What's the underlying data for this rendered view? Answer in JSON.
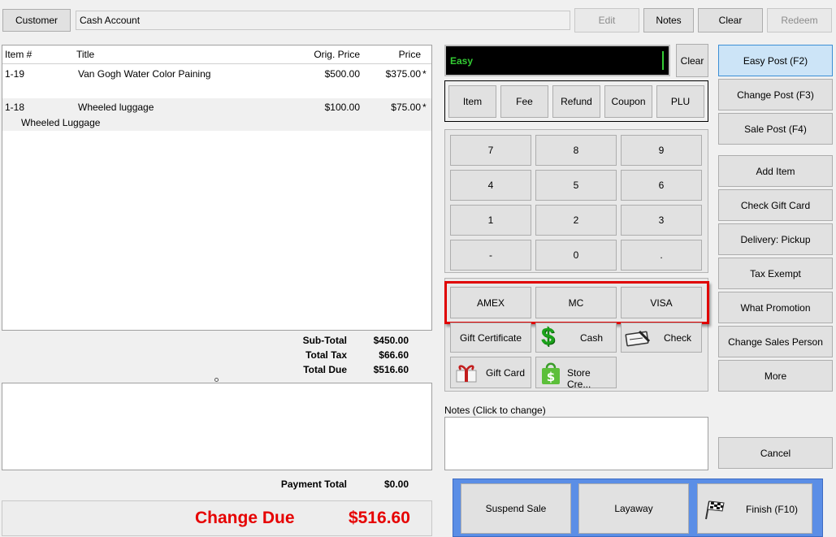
{
  "top": {
    "customer_button": "Customer",
    "customer_field": "Cash Account",
    "edit": "Edit",
    "notes": "Notes",
    "clear": "Clear",
    "redeem": "Redeem"
  },
  "items_table": {
    "headers": {
      "item_no": "Item #",
      "title": "Title",
      "orig_price": "Orig. Price",
      "price": "Price"
    },
    "rows": [
      {
        "item_no": "1-19",
        "title": "Van Gogh Water Color Paining",
        "orig_price": "$500.00",
        "price": "$375.00",
        "flag": "*",
        "sub": ""
      },
      {
        "item_no": "1-18",
        "title": "Wheeled luggage",
        "orig_price": "$100.00",
        "price": "$75.00",
        "flag": "*",
        "sub": "Wheeled Luggage"
      }
    ]
  },
  "totals": {
    "subtotal_label": "Sub-Total",
    "subtotal": "$450.00",
    "tax_label": "Total Tax",
    "tax": "$66.60",
    "due_label": "Total Due",
    "due": "$516.60",
    "payment_label": "Payment Total",
    "payment": "$0.00",
    "change_label": "Change Due",
    "change": "$516.60"
  },
  "entry": {
    "mode_text": "Easy",
    "clear": "Clear"
  },
  "type_buttons": [
    "Item",
    "Fee",
    "Refund",
    "Coupon",
    "PLU"
  ],
  "keypad": [
    "7",
    "8",
    "9",
    "4",
    "5",
    "6",
    "1",
    "2",
    "3",
    "-",
    "0",
    "."
  ],
  "cards": [
    "AMEX",
    "MC",
    "VISA"
  ],
  "tender": {
    "gift_certificate": "Gift Certificate",
    "cash": "Cash",
    "check": "Check",
    "gift_card": "Gift Card",
    "store_credit": "Store Cre..."
  },
  "notes_label": "Notes (Click to change)",
  "right_buttons": {
    "easy_post": "Easy Post (F2)",
    "change_post": "Change Post (F3)",
    "sale_post": "Sale Post (F4)",
    "add_item": "Add Item",
    "check_gift_card": "Check Gift Card",
    "delivery": "Delivery: Pickup",
    "tax_exempt": "Tax Exempt",
    "what_promotion": "What Promotion",
    "change_sales_person": "Change Sales Person",
    "more": "More",
    "cancel": "Cancel"
  },
  "bottom": {
    "suspend": "Suspend Sale",
    "layaway": "Layaway",
    "finish": "Finish (F10)"
  },
  "colors": {
    "highlight_red": "#e00000",
    "change_red": "#e60000",
    "easy_green": "#33cc33",
    "bottom_blue": "#5b8ee6",
    "active_blue": "#cce4f7"
  }
}
